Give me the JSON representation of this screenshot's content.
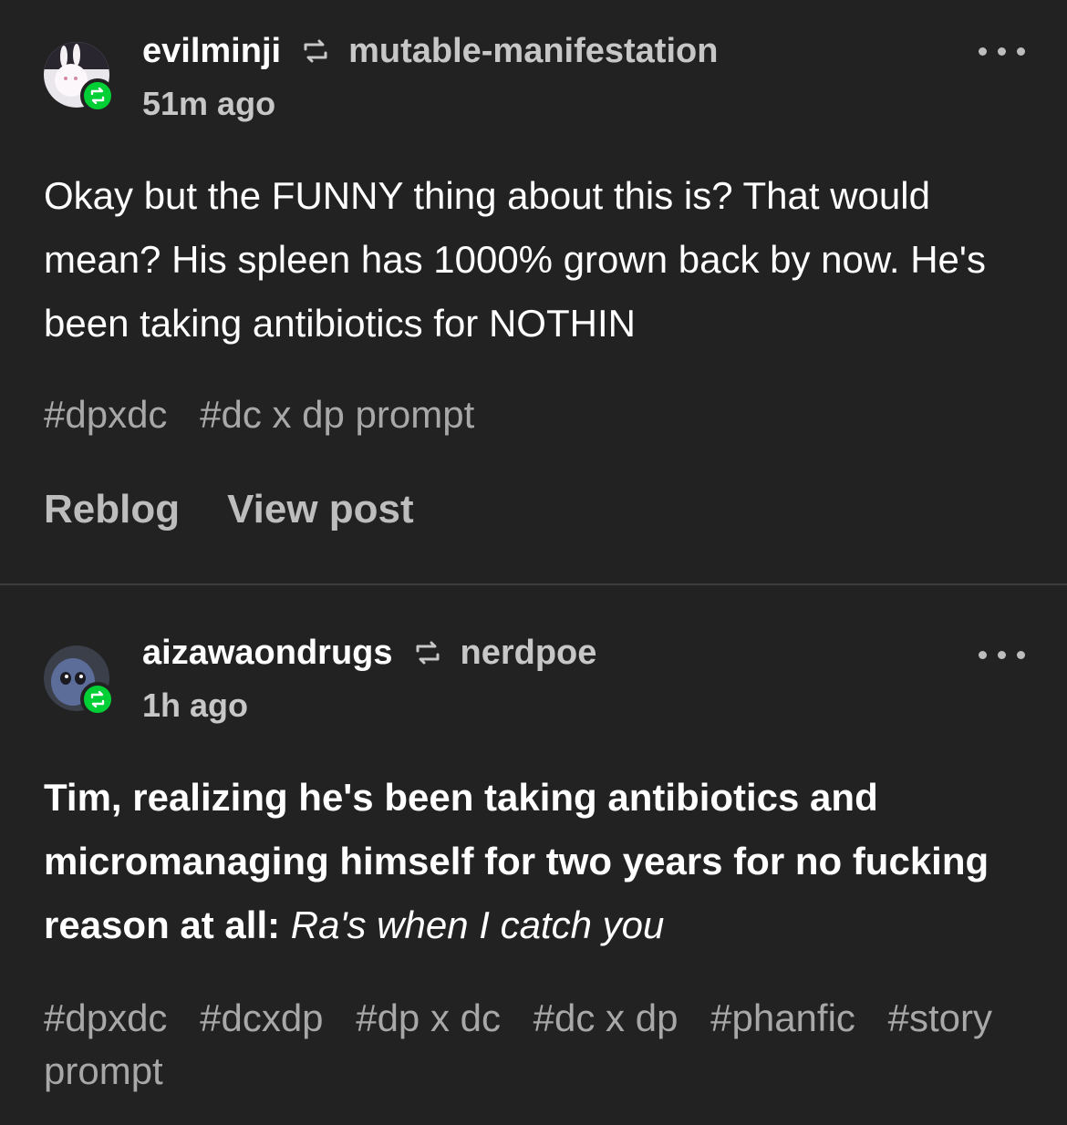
{
  "posts": [
    {
      "username": "evilminji",
      "source": "mutable-manifestation",
      "time": "51m ago",
      "body": "Okay but the FUNNY thing about this is? That would mean? His spleen has 1000% grown back by now. He's been taking antibiotics for NOTHIN",
      "tags": [
        "#dpxdc",
        "#dc x dp prompt"
      ],
      "actions": {
        "reblog": "Reblog",
        "view": "View post"
      }
    },
    {
      "username": "aizawaondrugs",
      "source": "nerdpoe",
      "time": "1h ago",
      "body_bold": "Tim, realizing he's been taking antibiotics and micromanaging himself for two years for no fucking reason at all:",
      "body_italic": "Ra's when I catch you",
      "tags": [
        "#dpxdc",
        "#dcxdp",
        "#dp x dc",
        "#dc x dp",
        "#phanfic",
        "#story prompt"
      ]
    }
  ],
  "colors": {
    "background": "#222222",
    "reblog_green": "#00cf35",
    "muted": "#a8a8a8"
  },
  "icons": [
    "reblog-icon",
    "more-options-icon",
    "avatar"
  ]
}
